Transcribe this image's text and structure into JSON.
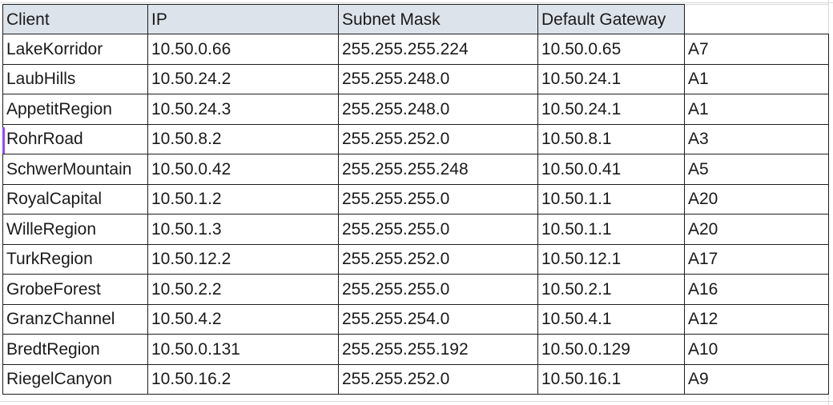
{
  "columns": [
    "Client",
    "IP",
    "Subnet Mask",
    "Default Gateway",
    ""
  ],
  "rows": [
    [
      "LakeKorridor",
      "10.50.0.66",
      "255.255.255.224",
      "10.50.0.65",
      "A7"
    ],
    [
      "LaubHills",
      "10.50.24.2",
      "255.255.248.0",
      "10.50.24.1",
      "A1"
    ],
    [
      "AppetitRegion",
      "10.50.24.3",
      "255.255.248.0",
      "10.50.24.1",
      "A1"
    ],
    [
      "RohrRoad",
      "10.50.8.2",
      "255.255.252.0",
      "10.50.8.1",
      "A3"
    ],
    [
      "SchwerMountain",
      "10.50.0.42",
      "255.255.255.248",
      "10.50.0.41",
      "A5"
    ],
    [
      "RoyalCapital",
      "10.50.1.2",
      "255.255.255.0",
      "10.50.1.1",
      "A20"
    ],
    [
      "WilleRegion",
      "10.50.1.3",
      "255.255.255.0",
      "10.50.1.1",
      "A20"
    ],
    [
      "TurkRegion",
      "10.50.12.2",
      "255.255.252.0",
      "10.50.12.1",
      "A17"
    ],
    [
      "GrobeForest",
      "10.50.2.2",
      "255.255.255.0",
      "10.50.2.1",
      "A16"
    ],
    [
      "GranzChannel",
      "10.50.4.2",
      "255.255.254.0",
      "10.50.4.1",
      "A12"
    ],
    [
      "BredtRegion",
      "10.50.0.131",
      "255.255.255.192",
      "10.50.0.129",
      "A10"
    ],
    [
      "RiegelCanyon",
      "10.50.16.2",
      "255.255.252.0",
      "10.50.16.1",
      "A9"
    ]
  ],
  "colors": {
    "header_fill": "#dde3ea",
    "border": "#1e1e1e",
    "selection_marker": "#8a4dff"
  }
}
